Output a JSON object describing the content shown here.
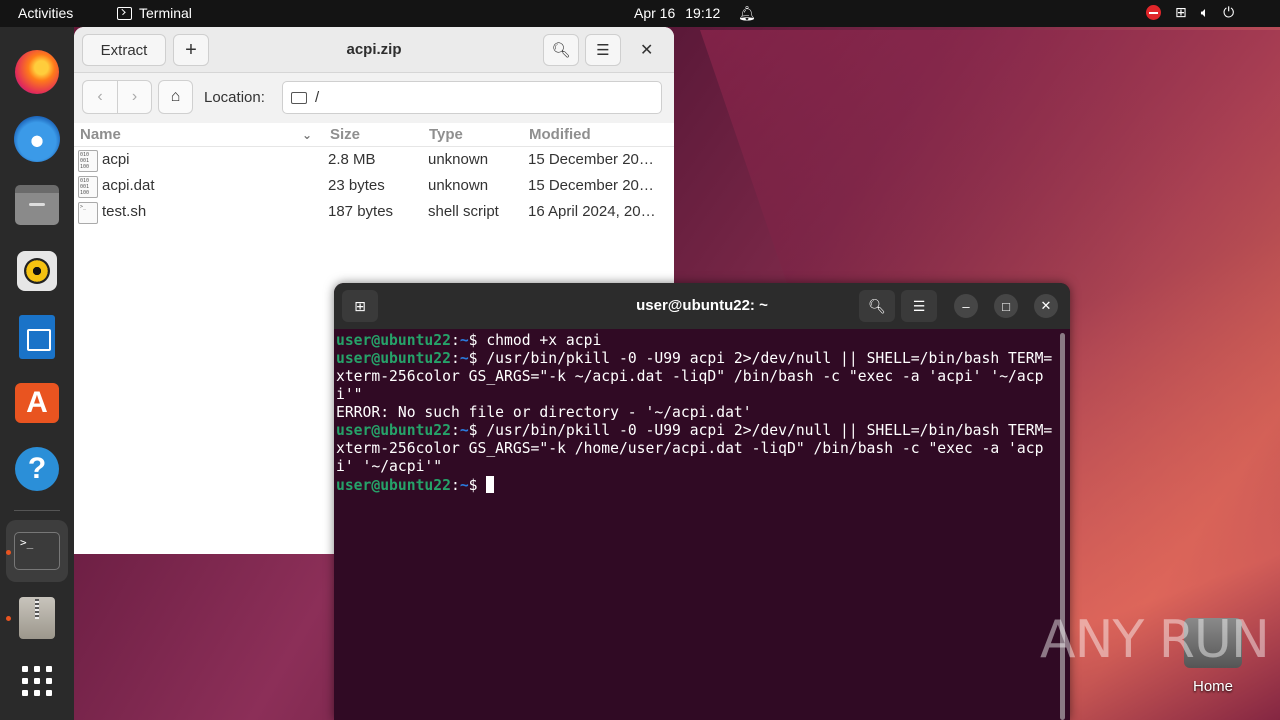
{
  "topbar": {
    "activities": "Activities",
    "app_name": "Terminal",
    "date": "Apr 16",
    "time": "19:12",
    "tray_icons": [
      "do-not-disturb-icon",
      "network-icon",
      "volume-icon",
      "power-icon"
    ]
  },
  "dock": {
    "apps": [
      "Firefox",
      "Thunderbird",
      "Files",
      "Rhythmbox",
      "LibreOffice Writer",
      "Ubuntu Software",
      "Help",
      "Terminal",
      "Archive Manager",
      "Show Applications"
    ],
    "terminal_icon_text": ">_"
  },
  "file_roller": {
    "extract_label": "Extract",
    "add_label": "+",
    "title": "acpi.zip",
    "location_label": "Location:",
    "location_value": "/",
    "columns": {
      "name": "Name",
      "size": "Size",
      "type": "Type",
      "modified": "Modified"
    },
    "rows": [
      {
        "name": "acpi",
        "size": "2.8 MB",
        "type": "unknown",
        "modified": "15 December 20…",
        "icon": "binary-file-icon"
      },
      {
        "name": "acpi.dat",
        "size": "23 bytes",
        "type": "unknown",
        "modified": "15 December 20…",
        "icon": "binary-file-icon"
      },
      {
        "name": "test.sh",
        "size": "187 bytes",
        "type": "shell script",
        "modified": "16 April 2024, 20…",
        "icon": "script-file-icon"
      }
    ]
  },
  "terminal": {
    "title": "user@ubuntu22: ~",
    "prompt_user": "user@ubuntu22",
    "prompt_path": "~",
    "lines": [
      {
        "cmd": "chmod +x acpi"
      },
      {
        "cmd": "/usr/bin/pkill -0 -U99 acpi 2>/dev/null || SHELL=/bin/bash TERM=xterm-256color GS_ARGS=\"-k ~/acpi.dat -liqD\" /bin/bash -c \"exec -a 'acpi' '~/acpi'\""
      },
      {
        "output": "ERROR: No such file or directory - '~/acpi.dat'"
      },
      {
        "cmd": "/usr/bin/pkill -0 -U99 acpi 2>/dev/null || SHELL=/bin/bash TERM=xterm-256color GS_ARGS=\"-k /home/user/acpi.dat -liqD\" /bin/bash -c \"exec -a 'acpi' '~/acpi'\""
      },
      {
        "cmd": ""
      }
    ]
  },
  "desktop": {
    "home_label": "Home",
    "watermark": "ANY RUN"
  },
  "colors": {
    "ubuntu_orange": "#e95420",
    "terminal_bg": "#300a24",
    "prompt_green": "#26a269",
    "prompt_blue": "#2a7bde"
  }
}
